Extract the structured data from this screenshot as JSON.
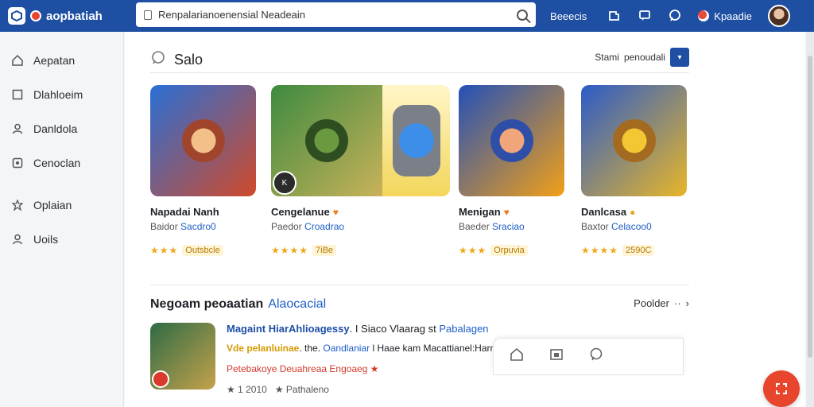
{
  "header": {
    "brand": "aopbatiah",
    "search_value": "Renpalarianoenensial Neadeain",
    "link": "Beeecis",
    "user_name": "Kpaadie"
  },
  "sidebar": {
    "items": [
      {
        "label": "Aepatan",
        "icon": "home-icon"
      },
      {
        "label": "Dlahloeim",
        "icon": "square-icon"
      },
      {
        "label": "Danldola",
        "icon": "user-icon"
      },
      {
        "label": "Cenoclan",
        "icon": "badge-icon"
      },
      {
        "label": "Oplaian",
        "icon": "settings-icon"
      },
      {
        "label": "Uoils",
        "icon": "person-icon"
      }
    ]
  },
  "section1": {
    "title": "Salo",
    "sort_label": "Stami",
    "sort_value": "penoudali"
  },
  "cards": [
    {
      "title": "Napadai Nanh",
      "sub_a": "Baidor",
      "sub_b": "Sacdro0",
      "rating": "Outsbcle",
      "heart": "",
      "colors": [
        "#2a6fd6",
        "#d04a2a"
      ]
    },
    {
      "title": "Cengelanue",
      "sub_a": "Paedor",
      "sub_b": "Croadrao",
      "rating": "7iBe",
      "heart": "♥",
      "colors": [
        "#3d8a3f",
        "#c9b25a"
      ]
    },
    {
      "title": "Menigan",
      "sub_a": "Baeder",
      "sub_b": "Sraciao",
      "rating": "Orpuvia",
      "heart": "♥",
      "colors": [
        "#2350b8",
        "#f2a017"
      ]
    },
    {
      "title": "Danlcasa",
      "sub_a": "Baxtor",
      "sub_b": "Celacoo0",
      "rating": "2590C",
      "heart": "●",
      "colors": [
        "#2b5bc9",
        "#e8b628"
      ]
    }
  ],
  "section2": {
    "title": "Negoam peoaatian",
    "link": "Alaocacial",
    "more": "Poolder"
  },
  "news": {
    "line1_bold": "Magaint HiarAhlioagessy",
    "line1_rest": ". I Siaco Vlaarag st",
    "line1_link": "Pabalagen",
    "line2_yellow": "Vde pelanluinae",
    "line2_dot": ". the.",
    "line2_link": "Oandlaniar",
    "line2_rest": "l Haae kam Macattianel:Harnabordenenolenlaprtire aronqial.",
    "line3": "Petebakoye Deuahreaa Engoaeg ★",
    "line4_a": "★ 1 2010",
    "line4_b": "★ Pathaleno"
  },
  "colors": {
    "primary": "#1e4fa3",
    "accent": "#e8452d",
    "link": "#1e5fc9"
  }
}
